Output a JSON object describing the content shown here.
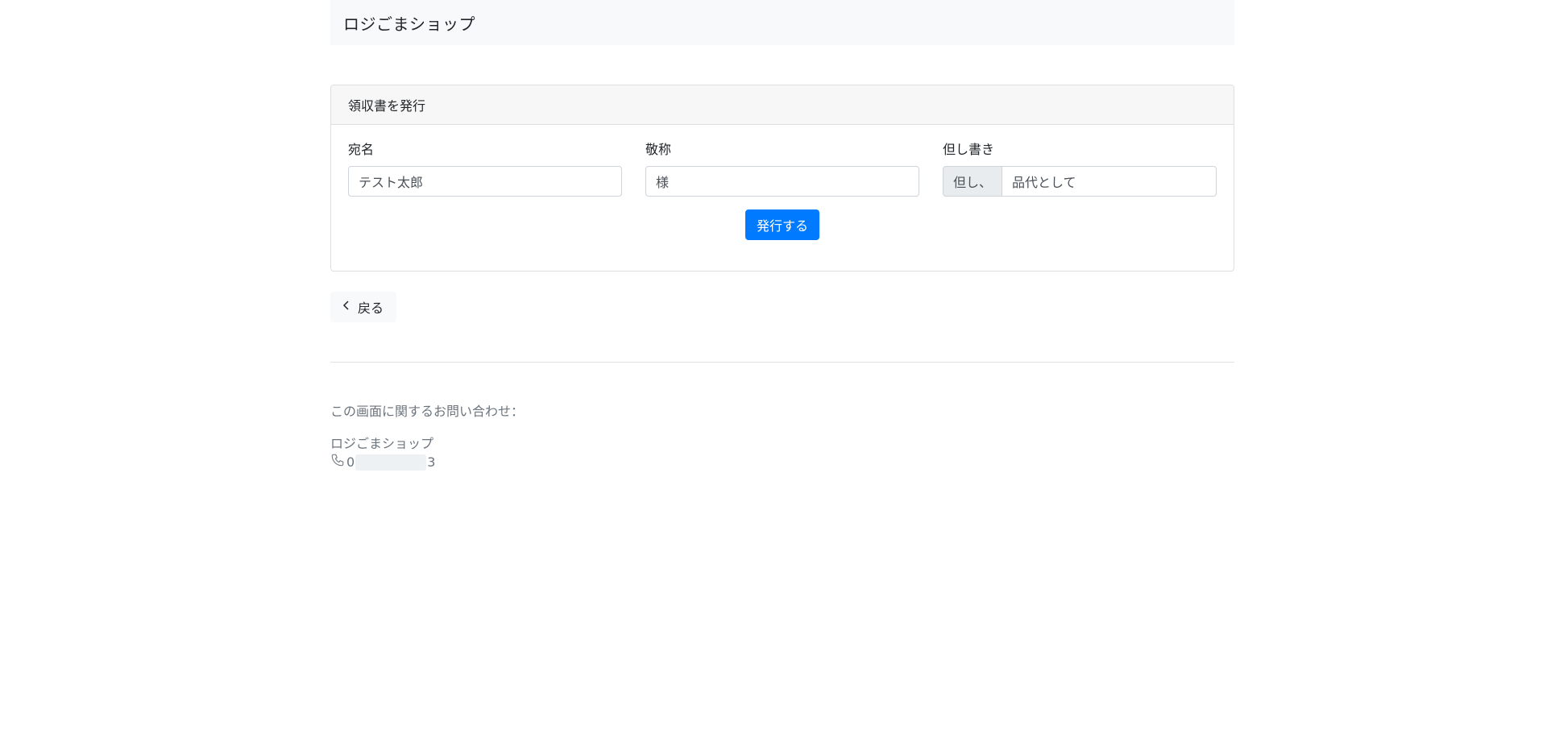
{
  "navbar": {
    "brand": "ロジごまショップ"
  },
  "card": {
    "header": "領収書を発行",
    "fields": {
      "addressee": {
        "label": "宛名",
        "value": "テスト太郎"
      },
      "honorific": {
        "label": "敬称",
        "value": "様"
      },
      "note": {
        "label": "但し書き",
        "prefix": "但し、",
        "value": "品代として"
      }
    },
    "submit_label": "発行する"
  },
  "back_label": "戻る",
  "footer": {
    "contact_heading": "この画面に関するお問い合わせ：",
    "shop_name": "ロジごまショップ",
    "phone_prefix": "0",
    "phone_suffix": "3"
  },
  "colors": {
    "primary": "#007bff",
    "navbar_bg": "#f8f9fa",
    "muted_text": "#6c757d"
  }
}
